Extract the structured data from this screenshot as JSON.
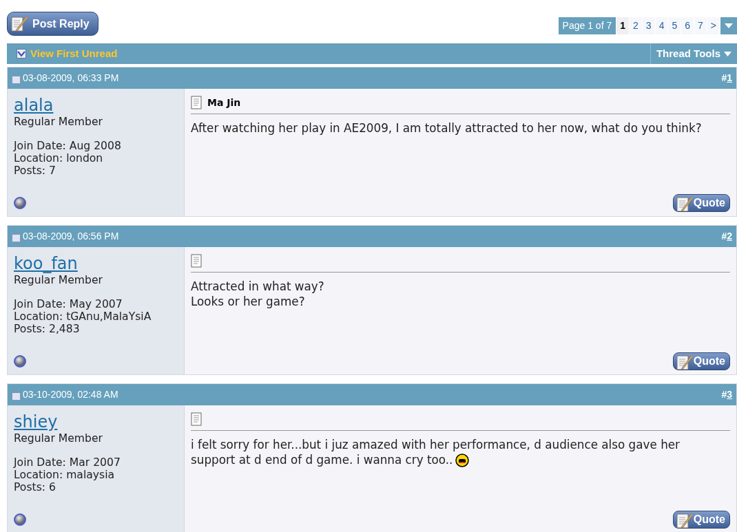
{
  "post_reply_button": {
    "label": "Post Reply"
  },
  "pager": {
    "label": "Page 1 of 7",
    "pages": [
      {
        "label": "1",
        "selected": true
      },
      {
        "label": "2",
        "selected": false
      },
      {
        "label": "3",
        "selected": false
      },
      {
        "label": "4",
        "selected": false
      },
      {
        "label": "5",
        "selected": false
      },
      {
        "label": "6",
        "selected": false
      },
      {
        "label": "7",
        "selected": false
      }
    ],
    "next": ">"
  },
  "toolbar": {
    "view_first_unread": "View First Unread",
    "thread_tools": "Thread Tools"
  },
  "posts": [
    {
      "date": "03-08-2009, 06:33 PM",
      "number_prefix": "#",
      "number": "1",
      "username": "alala",
      "rank": "Regular Member",
      "details": [
        "Join Date: Aug 2008",
        "Location: london",
        "Posts: 7"
      ],
      "title": "Ma Jin",
      "message": [
        "After watching her play in AE2009, I am totally attracted to her now, what do you think?"
      ],
      "emoticon": false,
      "quote": "Quote"
    },
    {
      "date": "03-08-2009, 06:56 PM",
      "number_prefix": "#",
      "number": "2",
      "username": "koo_fan",
      "rank": "Regular Member",
      "details": [
        "Join Date: May 2007",
        "Location: tGAnu,MalaYsiA",
        "Posts: 2,483"
      ],
      "message": [
        "Attracted in what way?",
        "Looks or her game?"
      ],
      "emoticon": false,
      "quote": "Quote"
    },
    {
      "date": "03-10-2009, 02:48 AM",
      "number_prefix": "#",
      "number": "3",
      "username": "shiey",
      "rank": "Regular Member",
      "details": [
        "Join Date: Mar 2007",
        "Location: malaysia",
        "Posts: 6"
      ],
      "message": [
        "i felt sorry for her...but i juz amazed with her performance, d audience also gave her",
        "support at d end of d game. i wanna cry too.."
      ],
      "emoticon": true,
      "quote": "Quote"
    }
  ]
}
